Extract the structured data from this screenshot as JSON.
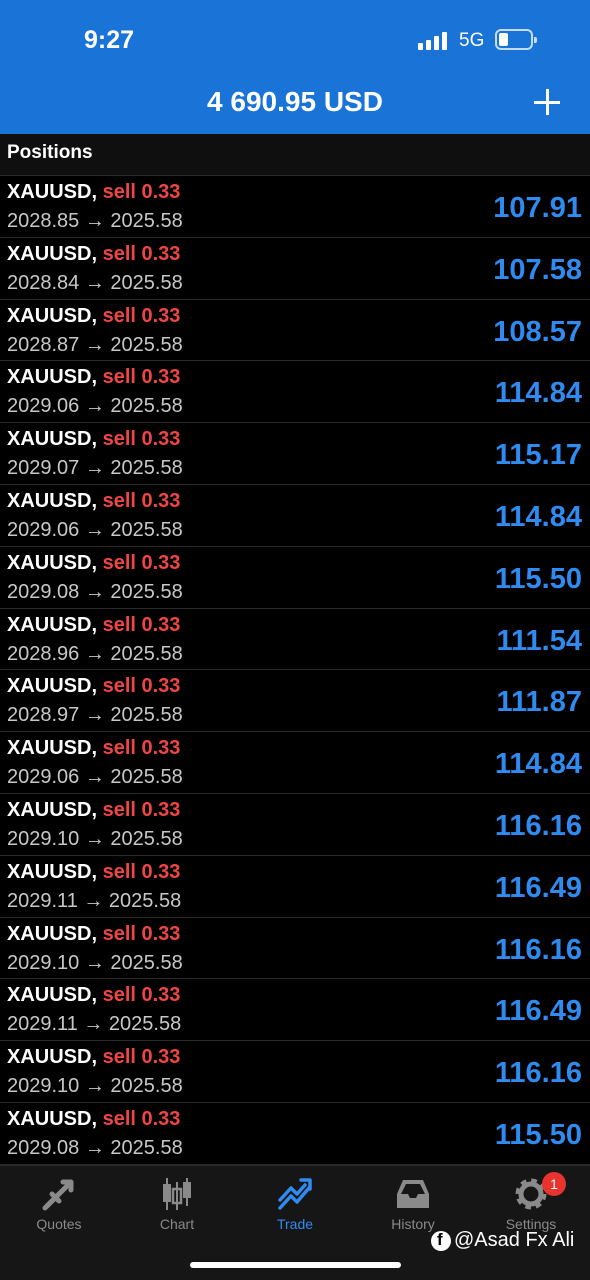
{
  "status_bar": {
    "time": "9:27",
    "network": "5G"
  },
  "header": {
    "balance": "4 690.95 USD"
  },
  "section": {
    "title": "Positions"
  },
  "positions": [
    {
      "symbol": "XAUUSD,",
      "side": "sell 0.33",
      "prices": "2028.85 → 2025.58",
      "profit": "107.91"
    },
    {
      "symbol": "XAUUSD,",
      "side": "sell 0.33",
      "prices": "2028.84 → 2025.58",
      "profit": "107.58"
    },
    {
      "symbol": "XAUUSD,",
      "side": "sell 0.33",
      "prices": "2028.87 → 2025.58",
      "profit": "108.57"
    },
    {
      "symbol": "XAUUSD,",
      "side": "sell 0.33",
      "prices": "2029.06 → 2025.58",
      "profit": "114.84"
    },
    {
      "symbol": "XAUUSD,",
      "side": "sell 0.33",
      "prices": "2029.07 → 2025.58",
      "profit": "115.17"
    },
    {
      "symbol": "XAUUSD,",
      "side": "sell 0.33",
      "prices": "2029.06 → 2025.58",
      "profit": "114.84"
    },
    {
      "symbol": "XAUUSD,",
      "side": "sell 0.33",
      "prices": "2029.08 → 2025.58",
      "profit": "115.50"
    },
    {
      "symbol": "XAUUSD,",
      "side": "sell 0.33",
      "prices": "2028.96 → 2025.58",
      "profit": "111.54"
    },
    {
      "symbol": "XAUUSD,",
      "side": "sell 0.33",
      "prices": "2028.97 → 2025.58",
      "profit": "111.87"
    },
    {
      "symbol": "XAUUSD,",
      "side": "sell 0.33",
      "prices": "2029.06 → 2025.58",
      "profit": "114.84"
    },
    {
      "symbol": "XAUUSD,",
      "side": "sell 0.33",
      "prices": "2029.10 → 2025.58",
      "profit": "116.16"
    },
    {
      "symbol": "XAUUSD,",
      "side": "sell 0.33",
      "prices": "2029.11 → 2025.58",
      "profit": "116.49"
    },
    {
      "symbol": "XAUUSD,",
      "side": "sell 0.33",
      "prices": "2029.10 → 2025.58",
      "profit": "116.16"
    },
    {
      "symbol": "XAUUSD,",
      "side": "sell 0.33",
      "prices": "2029.11 → 2025.58",
      "profit": "116.49"
    },
    {
      "symbol": "XAUUSD,",
      "side": "sell 0.33",
      "prices": "2029.10 → 2025.58",
      "profit": "116.16"
    },
    {
      "symbol": "XAUUSD,",
      "side": "sell 0.33",
      "prices": "2029.08 → 2025.58",
      "profit": "115.50"
    }
  ],
  "tabs": [
    {
      "label": "Quotes",
      "icon": "quotes-icon",
      "active": false
    },
    {
      "label": "Chart",
      "icon": "chart-icon",
      "active": false
    },
    {
      "label": "Trade",
      "icon": "trade-icon",
      "active": true
    },
    {
      "label": "History",
      "icon": "history-icon",
      "active": false
    },
    {
      "label": "Settings",
      "icon": "settings-icon",
      "active": false,
      "badge": "1"
    }
  ],
  "watermark": "@Asad Fx Ali",
  "colors": {
    "header_bg": "#1a73d6",
    "sell": "#f04545",
    "profit": "#2f8bf0",
    "active_tab": "#2f8bf0"
  }
}
